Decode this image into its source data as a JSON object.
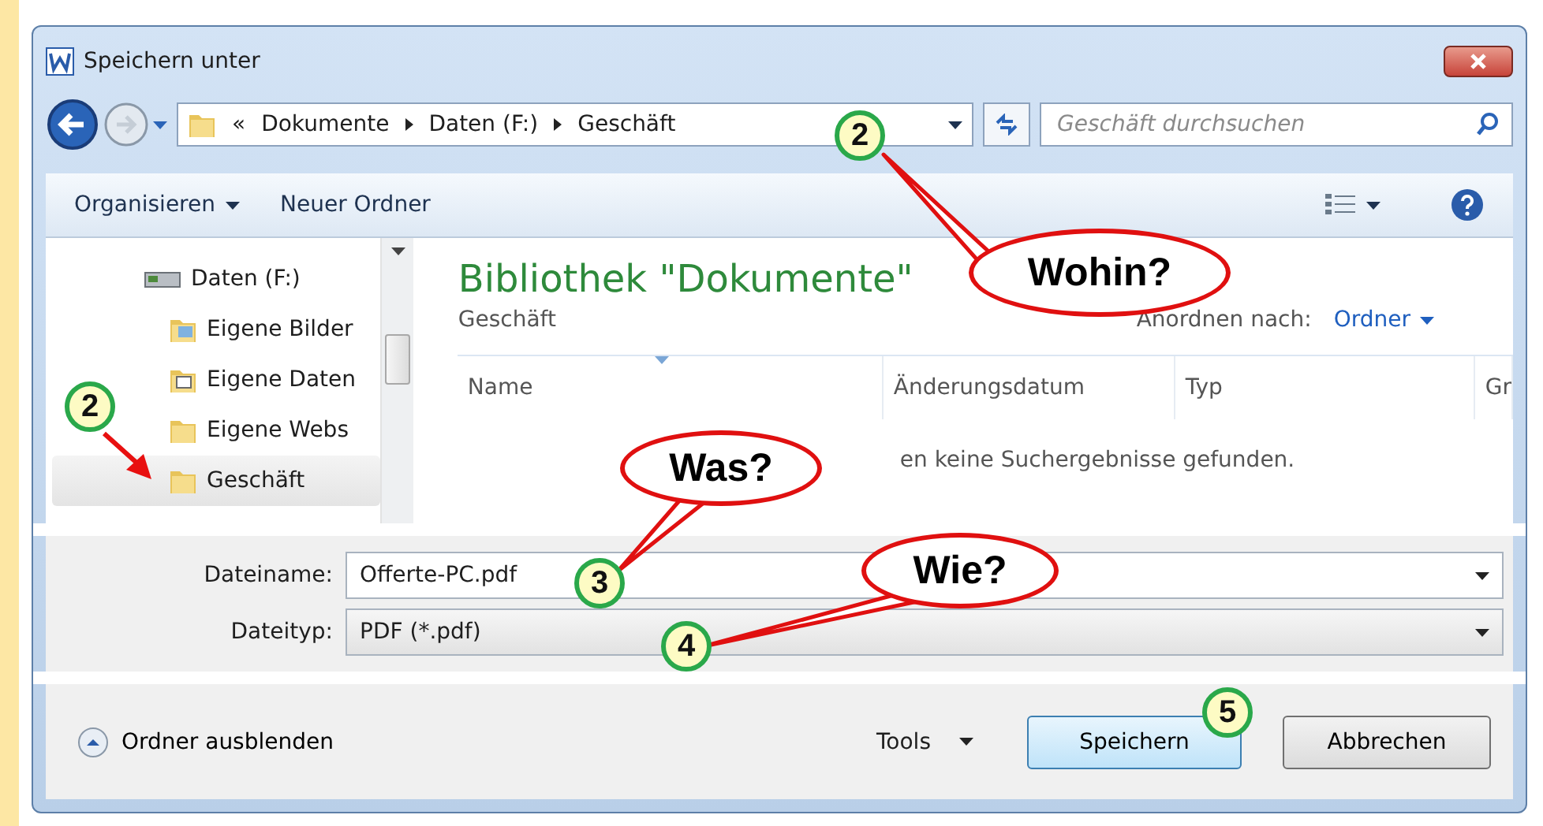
{
  "window": {
    "title": "Speichern unter"
  },
  "address_bar": {
    "path": [
      {
        "label": "«"
      },
      {
        "label": "Dokumente"
      },
      {
        "label": "Daten (F:)"
      },
      {
        "label": "Geschäft"
      }
    ]
  },
  "search": {
    "placeholder": "Geschäft durchsuchen"
  },
  "toolbar": {
    "buttons": [
      {
        "label": "Organisieren",
        "dropdown": true
      },
      {
        "label": "Neuer Ordner",
        "dropdown": false
      }
    ]
  },
  "sidebar": {
    "items": [
      {
        "label": "Daten (F:)",
        "kind": "drive",
        "selected": false,
        "children": [
          {
            "label": "Eigene Bilder",
            "kind": "pictures",
            "selected": false
          },
          {
            "label": "Eigene Daten",
            "kind": "data",
            "selected": false
          },
          {
            "label": "Eigene Webs",
            "kind": "folder",
            "selected": false
          },
          {
            "label": "Geschäft",
            "kind": "folder",
            "selected": true
          }
        ]
      }
    ]
  },
  "library": {
    "title": "Bibliothek \"Dokumente\"",
    "subtitle": "Geschäft",
    "arrange_label": "Anordnen nach:",
    "arrange_value": "Ordner"
  },
  "table": {
    "columns": [
      "Name",
      "Änderungsdatum",
      "Typ",
      "Gr"
    ],
    "empty_message": "en keine Suchergebnisse gefunden."
  },
  "form": {
    "fields": [
      {
        "label": "Dateiname:",
        "value": "Offerte-PC.pdf"
      },
      {
        "label": "Dateityp:",
        "value": "PDF (*.pdf)"
      }
    ]
  },
  "footer": {
    "toggle": "Ordner ausblenden",
    "tools": "Tools",
    "buttons": [
      {
        "label": "Speichern",
        "default": true
      },
      {
        "label": "Abbrechen",
        "default": false
      }
    ]
  },
  "annotations": {
    "markers": [
      {
        "label": "2"
      },
      {
        "label": "2"
      },
      {
        "label": "3"
      },
      {
        "label": "4"
      },
      {
        "label": "5"
      }
    ],
    "callouts": [
      {
        "label": "Wohin?"
      },
      {
        "label": "Was?"
      },
      {
        "label": "Wie?"
      }
    ]
  }
}
